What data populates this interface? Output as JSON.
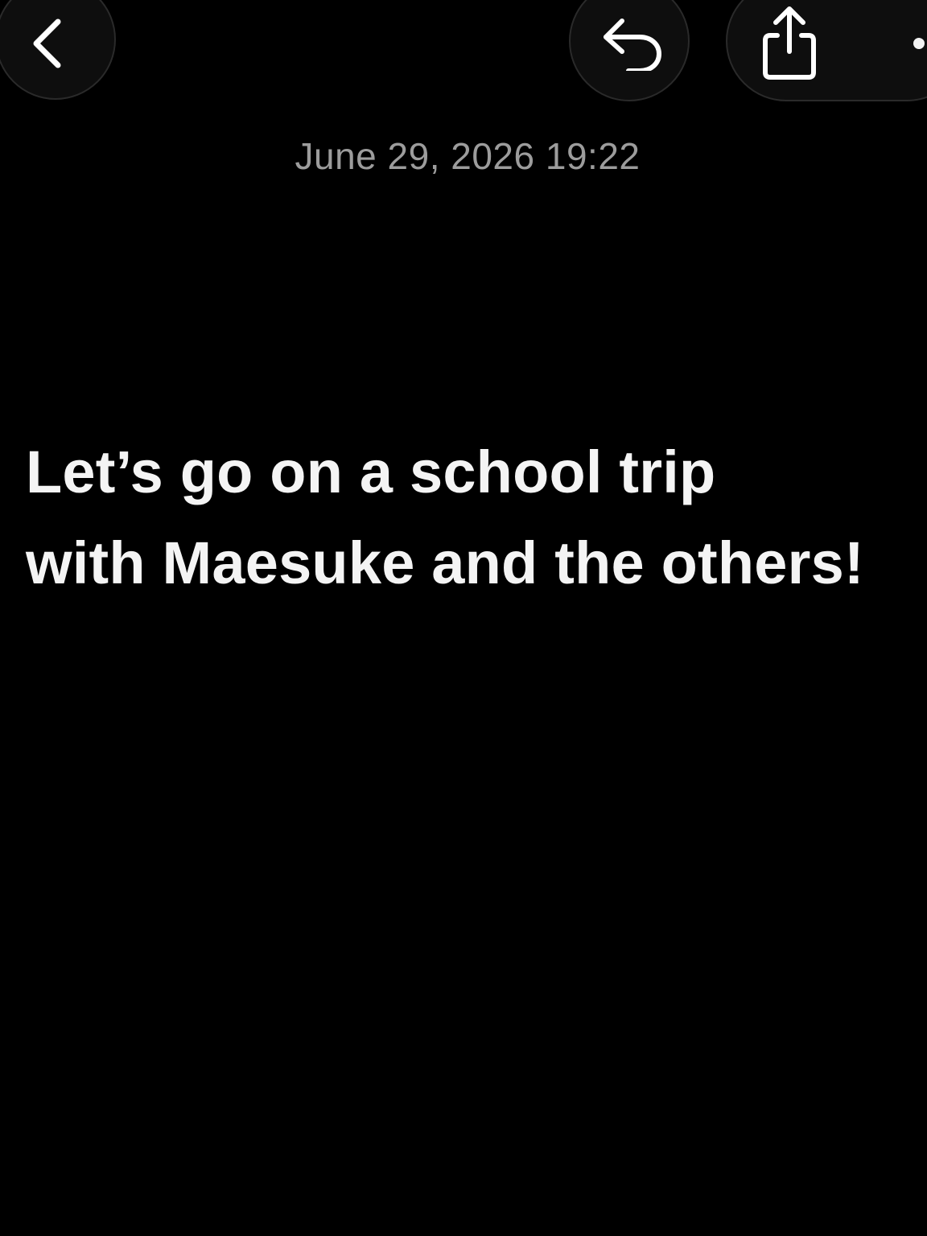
{
  "toolbar": {
    "back_icon": "chevron-left-icon",
    "undo_icon": "undo-arrow-icon",
    "share_icon": "share-icon",
    "more_icon": "more-icon"
  },
  "note": {
    "timestamp": "June 29, 2026 19:22",
    "lines": [
      "Let’s go on a school trip",
      "with Maesuke and the others!"
    ]
  },
  "colors": {
    "background": "#000000",
    "text": "#f4f4f4",
    "timestamp": "#9c9c9c",
    "button_fill": "#0e0e0e",
    "button_border": "#2a2a2a"
  }
}
